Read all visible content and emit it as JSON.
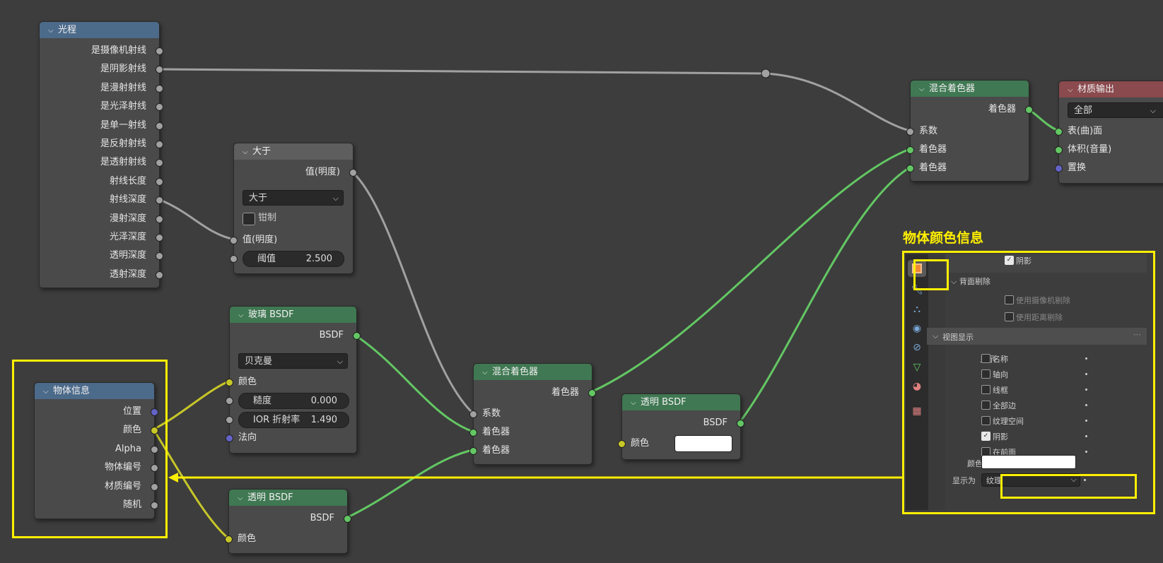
{
  "nodes": {
    "light_path": {
      "title": "光程",
      "outputs": [
        "是摄像机射线",
        "是阴影射线",
        "是漫射射线",
        "是光泽射线",
        "是单一射线",
        "是反射射线",
        "是透射射线",
        "射线长度",
        "射线深度",
        "漫射深度",
        "光泽深度",
        "透明深度",
        "透射深度"
      ]
    },
    "greater_than": {
      "title": "大于",
      "output": "值(明度)",
      "mode": "大于",
      "clamp_label": "钳制",
      "input_value": "值(明度)",
      "threshold_label": "阈值",
      "threshold_value": "2.500"
    },
    "glass_bsdf": {
      "title": "玻璃 BSDF",
      "output": "BSDF",
      "distribution": "贝克曼",
      "color_label": "颜色",
      "roughness_label": "糙度",
      "roughness_value": "0.000",
      "ior_label": "IOR 折射率",
      "ior_value": "1.490",
      "normal_label": "法向"
    },
    "object_info": {
      "title": "物体信息",
      "outputs": [
        "位置",
        "颜色",
        "Alpha",
        "物体编号",
        "材质编号",
        "随机"
      ]
    },
    "transparent_bsdf_1": {
      "title": "透明 BSDF",
      "output": "BSDF",
      "color_label": "颜色"
    },
    "mix_shader_mid": {
      "title": "混合着色器",
      "output": "着色器",
      "inputs": [
        "系数",
        "着色器",
        "着色器"
      ]
    },
    "transparent_bsdf_2": {
      "title": "透明 BSDF",
      "output": "BSDF",
      "color_label": "颜色"
    },
    "mix_shader_right": {
      "title": "混合着色器",
      "output": "着色器",
      "inputs": [
        "系数",
        "着色器",
        "着色器"
      ]
    },
    "material_output": {
      "title": "材质输出",
      "target": "全部",
      "inputs": [
        "表(曲)面",
        "体积(音量)",
        "置换"
      ]
    }
  },
  "annotation": {
    "title": "物体颜色信息"
  },
  "properties_panel": {
    "shadow_top_label": "阴影",
    "backface_section": "背面剔除",
    "use_camera_cull": "使用摄像机剔除",
    "use_distance_cull": "使用距离剔除",
    "viewport_section": "视图显示",
    "show_label": "显示",
    "show_options": [
      {
        "label": "名称",
        "checked": false
      },
      {
        "label": "轴向",
        "checked": false
      },
      {
        "label": "线框",
        "checked": false
      },
      {
        "label": "全部边",
        "checked": false
      },
      {
        "label": "纹理空间",
        "checked": false
      },
      {
        "label": "阴影",
        "checked": true
      },
      {
        "label": "在前面",
        "checked": false
      }
    ],
    "color_label": "颜色",
    "display_as_label": "显示为",
    "display_as_value": "纹理"
  },
  "colors": {
    "background": "#3d3d3d",
    "annotation_yellow": "#ffef00",
    "shader_wire": "#63c763",
    "value_wire": "#a1a1a1",
    "color_wire": "#c7c729"
  }
}
